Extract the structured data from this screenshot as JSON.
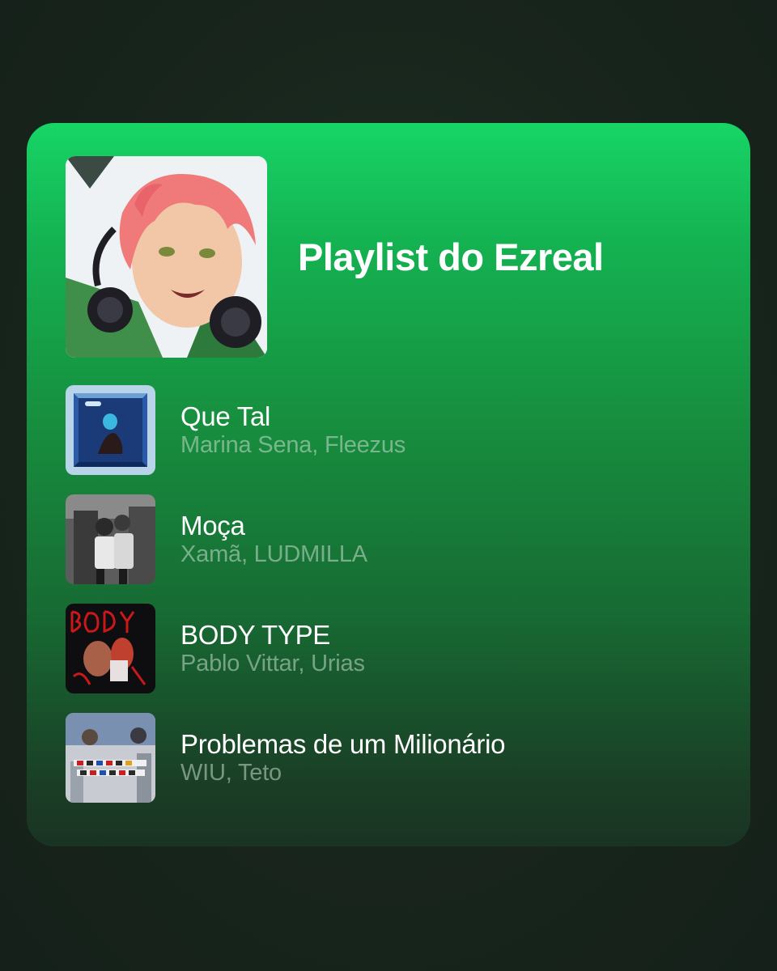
{
  "playlist": {
    "title": "Playlist do Ezreal",
    "cover_icon": "anime-character-headphones-image"
  },
  "tracks": [
    {
      "title": "Que Tal",
      "artist": "Marina Sena, Fleezus",
      "art": "album-art-que-tal"
    },
    {
      "title": "Moça",
      "artist": "Xamã, LUDMILLA",
      "art": "album-art-moca"
    },
    {
      "title": "BODY TYPE",
      "artist": "Pablo Vittar, Urias",
      "art": "album-art-body-type"
    },
    {
      "title": "Problemas de um Milionário",
      "artist": "WIU, Teto",
      "art": "album-art-problemas"
    }
  ],
  "colors": {
    "accent": "#17d566",
    "background": "#1a2a20"
  }
}
